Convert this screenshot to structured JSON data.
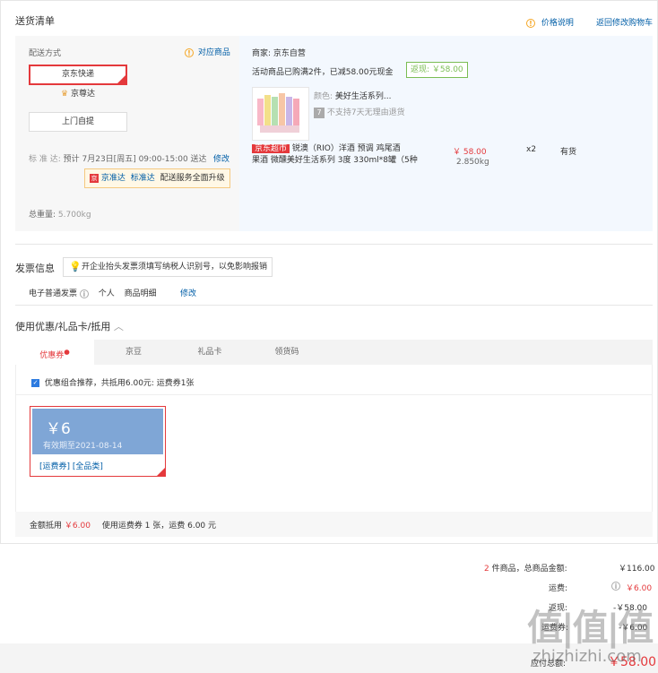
{
  "header": {
    "title": "送货清单",
    "price_help": "价格说明",
    "back_to_cart": "返回修改购物车"
  },
  "shipping": {
    "label": "配送方式",
    "matching_goods": "对应商品",
    "options": [
      {
        "label": "京东快递",
        "selected": true
      },
      {
        "label": "京尊达",
        "selected": false
      },
      {
        "label": "上门自提",
        "selected": false
      }
    ],
    "standard_label": "标 准 达:",
    "standard_time": "预计 7月23日[周五] 09:00-15:00 送达",
    "modify": "修改",
    "promo": {
      "icon_text": "京准达",
      "text1": "京准达",
      "text2": "标准达",
      "text3": "配送服务全面升级"
    },
    "total_weight_label": "总重量:",
    "total_weight_value": "5.700kg"
  },
  "merchant": {
    "label": "商家:",
    "name": "京东自营",
    "activity": "活动商品已购满2件，已减58.00元现金",
    "rebate": "返现: ￥58.00",
    "product": {
      "color_label": "颜色:",
      "color_value": "美好生活系列...",
      "return_icon": "7",
      "return_note": "不支持7天无理由退货",
      "tag": "京东超市",
      "name_line1": "锐澳（RIO）洋酒 预调 鸡尾酒",
      "name_line2": "果酒 微醺美好生活系列 3度 330ml*8罐（5种",
      "price": "￥ 58.00",
      "weight": "2.850kg",
      "qty": "x2",
      "stock": "有货"
    }
  },
  "invoice": {
    "title": "发票信息",
    "tip": "开企业抬头发票须填写纳税人识别号，以免影响报销",
    "type": "电子普通发票",
    "person": "个人",
    "detail": "商品明细",
    "modify": "修改"
  },
  "coupon": {
    "title": "使用优惠/礼品卡/抵用",
    "tabs": [
      "优惠券",
      "京豆",
      "礼品卡",
      "领货码"
    ],
    "recommend": "优惠组合推荐，共抵用6.00元: 运费券1张",
    "card": {
      "amount": "￥6",
      "expiry": "有效期至2021-08-14",
      "tag1": "[运费券]",
      "tag2": "[全品类]"
    },
    "summary_label": "金额抵用",
    "summary_amount": "￥6.00",
    "summary_note": "使用运费券 1 张，运费 6.00 元"
  },
  "totals": {
    "count_num": "2",
    "count_text": "件商品，总商品金额:",
    "goods_total": "￥116.00",
    "freight_label": "运费:",
    "freight_value": "￥6.00",
    "row3_label": "返现:",
    "row3_value": "-￥58.00",
    "row4_label": "运费券:",
    "row4_value": "-￥6.00",
    "payable_label": "应付总额:",
    "payable_value": "￥58.00"
  },
  "watermark": {
    "logo": "值|值|值",
    "url": "zhizhizhi.com"
  }
}
